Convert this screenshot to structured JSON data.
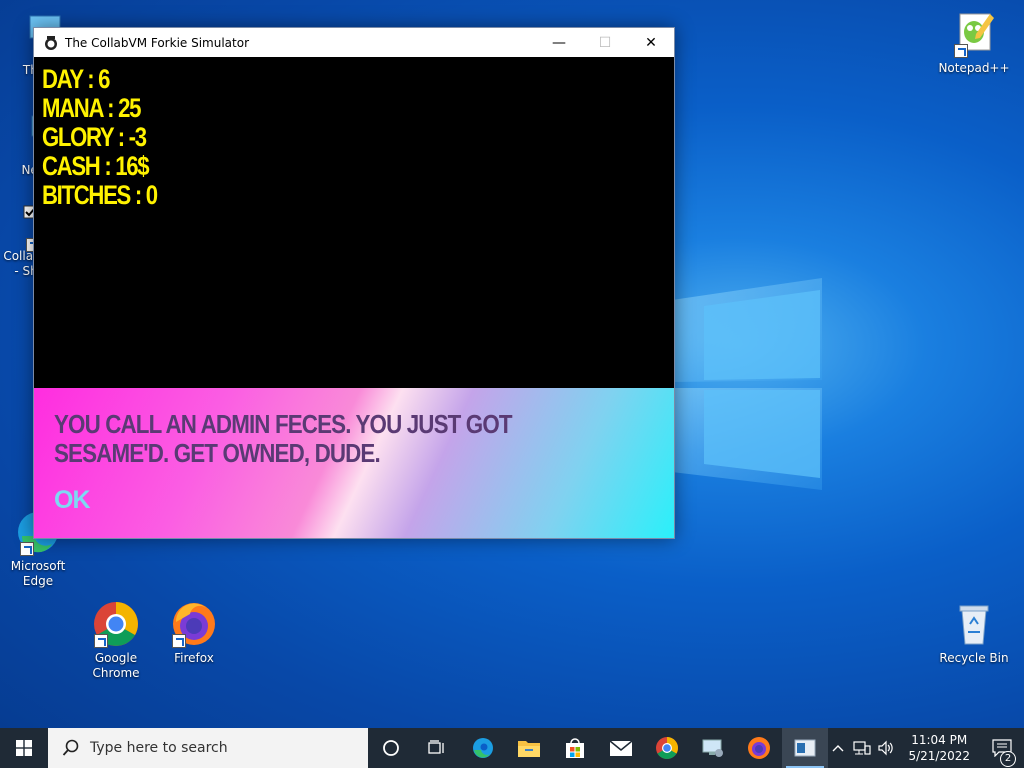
{
  "desktop": {
    "icons": [
      {
        "label": "This PC",
        "label_visible": "Thi"
      },
      {
        "label": "Network",
        "label_visible": "Net"
      },
      {
        "label_line1": "Collab",
        "label_line2": "- Sh"
      },
      {
        "label": "Notepad++"
      },
      {
        "label": "Microsoft Edge"
      },
      {
        "label": "Google Chrome"
      },
      {
        "label": "Firefox"
      },
      {
        "label": "Recycle Bin"
      }
    ]
  },
  "window": {
    "title": "The CollabVM Forkie Simulator",
    "minimize": "—",
    "maximize": "☐",
    "close": "✕"
  },
  "game": {
    "stats": [
      "DAY : 6",
      "MANA : 25",
      "GLORY : -3",
      "CASH : 16$",
      "BITCHES : 0"
    ],
    "message": "YOU CALL AN ADMIN FECES. YOU JUST GOT SESAME'D. GET OWNED, DUDE.",
    "ok_label": "OK"
  },
  "taskbar": {
    "search_placeholder": "Type here to search",
    "time": "11:04 PM",
    "date": "5/21/2022",
    "notification_count": "2"
  },
  "colors": {
    "stat_text": "#fff200",
    "message_text": "#5a3a74",
    "ok_text": "#7ed9f2",
    "taskbar_bg": "#1f2a36"
  }
}
